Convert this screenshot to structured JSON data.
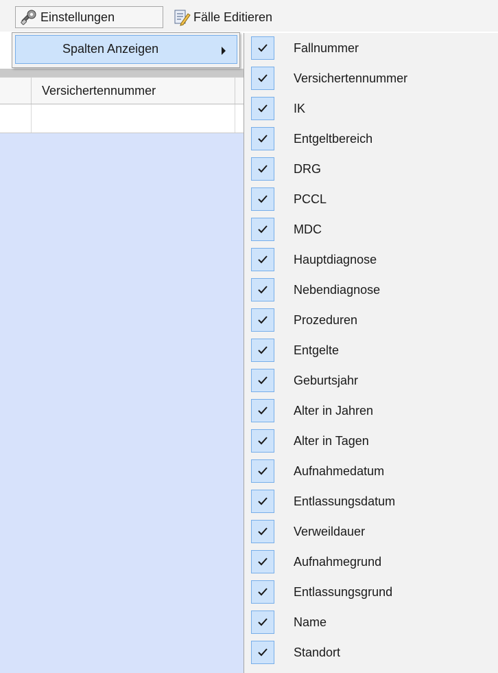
{
  "toolbar": {
    "settings_label": "Einstellungen",
    "settings_icon": "gear-wrench-icon",
    "edit_label": "Fälle Editieren",
    "edit_icon": "pencil-document-icon"
  },
  "dropdown": {
    "item_label": "Spalten Anzeigen",
    "item_icon": "chevron-right-icon"
  },
  "grid": {
    "column_header": "Versichertennummer",
    "background_color": "#d7e2fb"
  },
  "submenu": {
    "items": [
      {
        "label": "Fallnummer",
        "checked": true
      },
      {
        "label": "Versichertennummer",
        "checked": true
      },
      {
        "label": "IK",
        "checked": true
      },
      {
        "label": "Entgeltbereich",
        "checked": true
      },
      {
        "label": "DRG",
        "checked": true
      },
      {
        "label": "PCCL",
        "checked": true
      },
      {
        "label": "MDC",
        "checked": true
      },
      {
        "label": "Hauptdiagnose",
        "checked": true
      },
      {
        "label": "Nebendiagnose",
        "checked": true
      },
      {
        "label": "Prozeduren",
        "checked": true
      },
      {
        "label": "Entgelte",
        "checked": true
      },
      {
        "label": "Geburtsjahr",
        "checked": true
      },
      {
        "label": "Alter in Jahren",
        "checked": true
      },
      {
        "label": "Alter in Tagen",
        "checked": true
      },
      {
        "label": "Aufnahmedatum",
        "checked": true
      },
      {
        "label": "Entlassungsdatum",
        "checked": true
      },
      {
        "label": "Verweildauer",
        "checked": true
      },
      {
        "label": "Aufnahmegrund",
        "checked": true
      },
      {
        "label": "Entlassungsgrund",
        "checked": true
      },
      {
        "label": "Name",
        "checked": true
      },
      {
        "label": "Standort",
        "checked": true
      }
    ]
  },
  "colors": {
    "highlight": "#cde3fb",
    "highlight_border": "#77aee9",
    "menu_background": "#f2f2f2"
  }
}
